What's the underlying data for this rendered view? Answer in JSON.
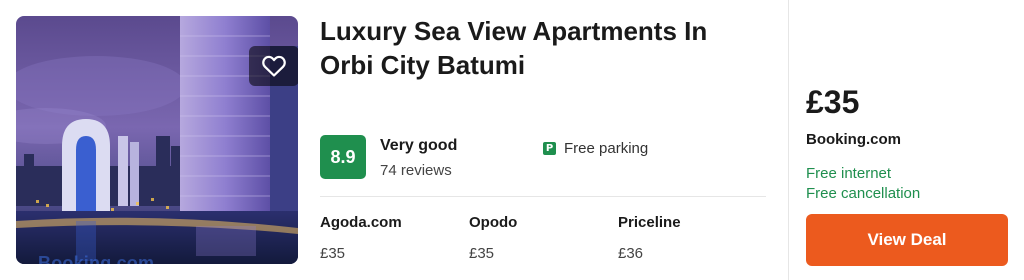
{
  "listing": {
    "title": "Luxury Sea View Apartments In Orbi City Batumi",
    "image_watermark": "Booking.com",
    "favorite_icon": "heart-icon",
    "rating": {
      "score": "8.9",
      "label": "Very good",
      "reviews": "74 reviews",
      "color": "#1f8f4e"
    },
    "amenities": [
      {
        "icon": "parking-icon",
        "glyph": "P",
        "label": "Free parking"
      }
    ],
    "providers": [
      {
        "name": "Agoda.com",
        "price": "£35"
      },
      {
        "name": "Opodo",
        "price": "£35"
      },
      {
        "name": "Priceline",
        "price": "£36"
      }
    ]
  },
  "deal": {
    "price": "£35",
    "site": "Booking.com",
    "perks": [
      "Free internet",
      "Free cancellation"
    ],
    "button_label": "View Deal",
    "accent_color": "#ec5a1e",
    "perk_color": "#1f8f4e"
  }
}
